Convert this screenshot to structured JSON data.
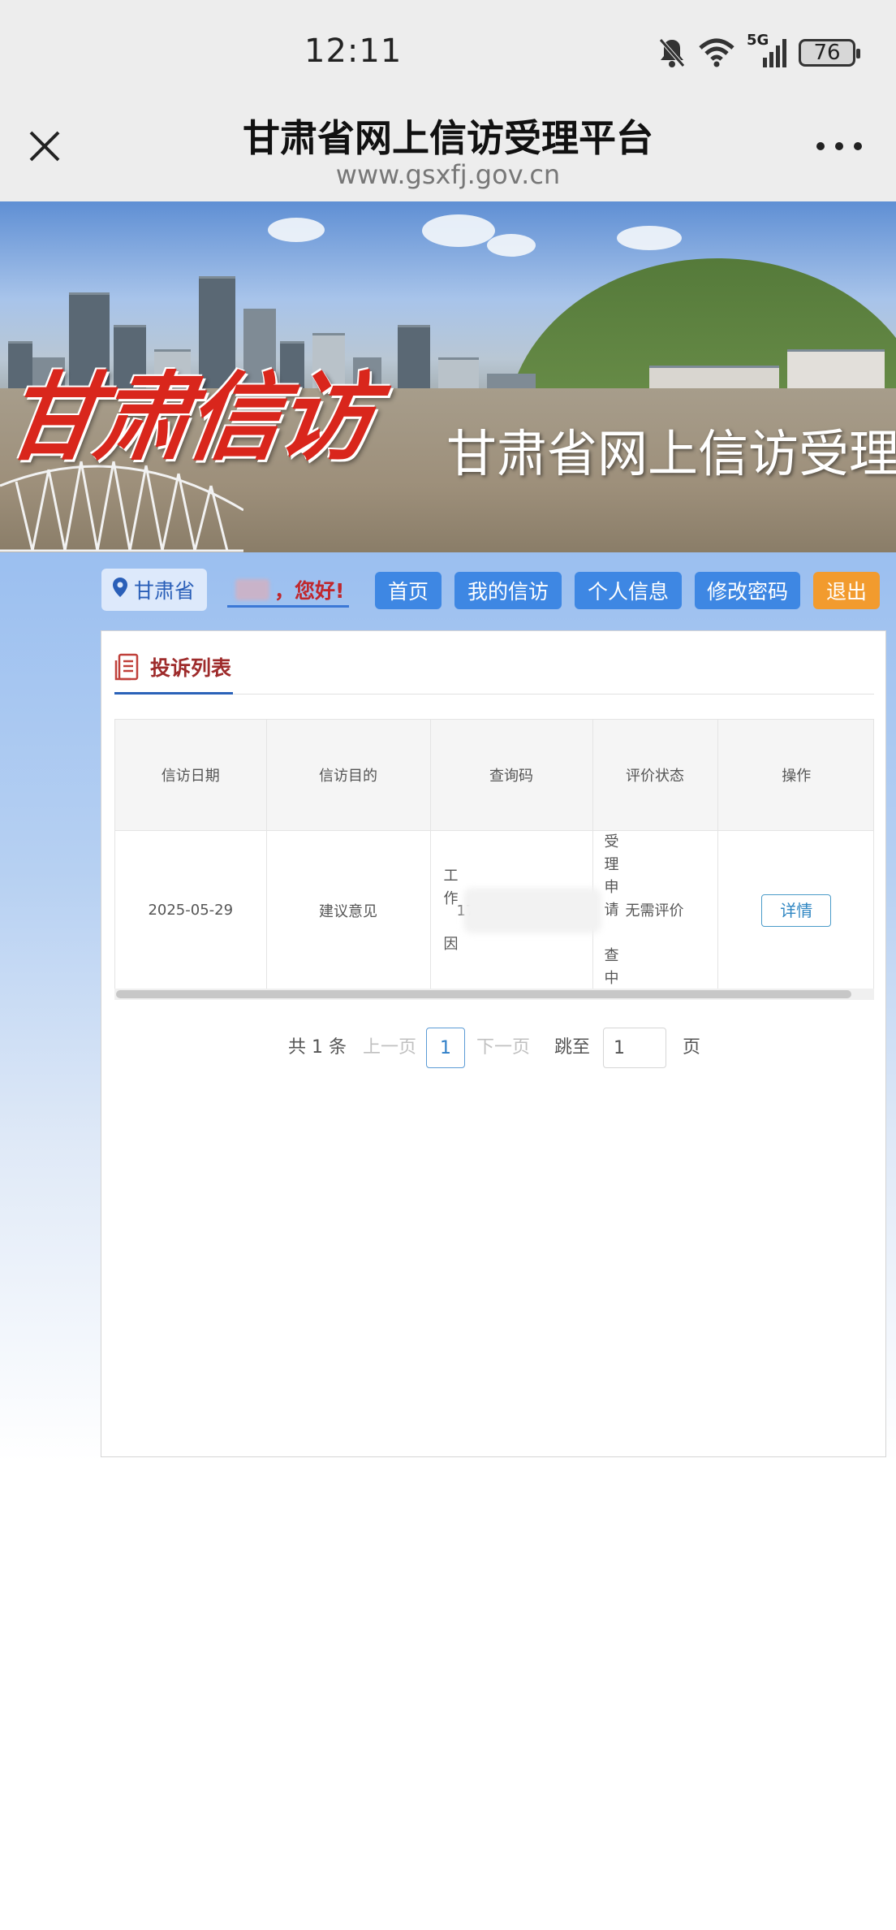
{
  "status_bar": {
    "time": "12:11",
    "network": "5G",
    "battery": "76"
  },
  "navbar": {
    "title": "甘肃省网上信访受理平台",
    "url": "www.gsxfj.gov.cn"
  },
  "banner": {
    "logo_text": "甘肃信访",
    "title": "甘肃省网上信访受理"
  },
  "toolbar": {
    "location": "甘肃省",
    "greeting": "，您好!",
    "buttons": [
      "首页",
      "我的信访",
      "个人信息",
      "修改密码",
      "退出"
    ],
    "colors": {
      "primary": "#3e87e3",
      "exit": "#f29b2e"
    }
  },
  "panel": {
    "title": "投诉列表",
    "table": {
      "headers": [
        "信访日期",
        "信访目的",
        "查询码",
        "评价状态",
        "操作"
      ],
      "rows": [
        {
          "date": "2025-05-29",
          "purpose": "建议意见",
          "query_chars": [
            "工",
            "作",
            "",
            "因"
          ],
          "query_partial": "174",
          "status_chars": [
            "受",
            "理",
            "申",
            "请",
            "",
            "查",
            "中"
          ],
          "evaluation": "无需评价",
          "action": "详情"
        }
      ]
    },
    "pager": {
      "total": "共 1 条",
      "prev": "上一页",
      "current": "1",
      "next": "下一页",
      "jump_label": "跳至",
      "jump_value": "1",
      "unit": "页"
    }
  }
}
